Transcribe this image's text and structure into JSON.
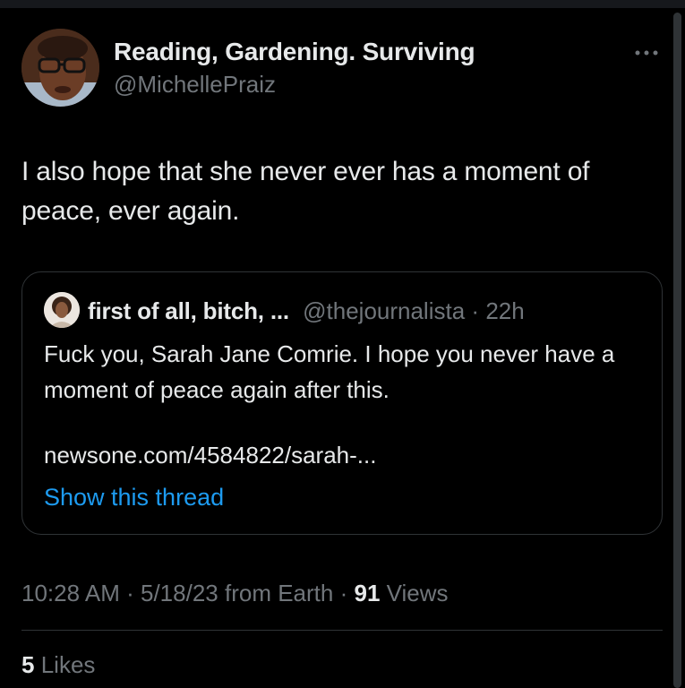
{
  "author": {
    "display_name": "Reading, Gardening. Surviving",
    "handle": "@MichellePraiz"
  },
  "icons": {
    "more": "more-horizontal-icon",
    "avatar": "profile-avatar",
    "quoted_avatar": "quoted-profile-avatar"
  },
  "tweet": {
    "text": "I also hope that she never ever has a moment of peace, ever again."
  },
  "quoted_tweet": {
    "display_name": "first of all, bitch, ...",
    "handle": "@thejournalista",
    "separator": "·",
    "time": "22h",
    "text": "Fuck you, Sarah Jane Comrie. I hope you never have a moment of peace again after this.",
    "link": "newsone.com/4584822/sarah-...",
    "show_thread_label": "Show this thread"
  },
  "meta": {
    "time": "10:28 AM",
    "separator": "·",
    "date": "5/18/23",
    "source": "from Earth",
    "views_count": "91",
    "views_label": "Views"
  },
  "likes": {
    "count": "5",
    "label": "Likes"
  },
  "colors": {
    "background": "#000000",
    "text_primary": "#e7e9ea",
    "text_secondary": "#71767b",
    "link": "#1d9bf0",
    "border": "#2f3336"
  }
}
